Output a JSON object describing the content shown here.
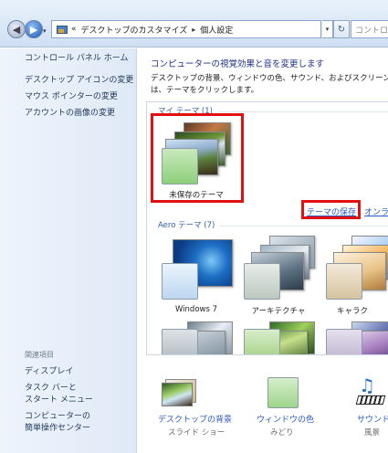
{
  "address_bar": {
    "breadcrumb_overflow": "«",
    "crumbs": [
      "デスクトップのカスタマイズ",
      "個人設定"
    ],
    "search_placeholder": "コントロー"
  },
  "sidebar": {
    "home": "コントロール パネル ホーム",
    "links": [
      "デスクトップ アイコンの変更",
      "マウス ポインターの変更",
      "アカウントの画像の変更"
    ],
    "related_heading": "関連項目",
    "related_links": [
      "ディスプレイ",
      "タスク バーと",
      "スタート メニュー",
      "コンピューターの",
      "簡単操作センター"
    ]
  },
  "main": {
    "title": "コンピューターの視覚効果と音を変更します",
    "desc_line1": "デスクトップの背景、ウィンドウの色、サウンド、およびスクリーン",
    "desc_line2": "は、テーマをクリックします。",
    "my_themes_label": "マイ テーマ (1)",
    "unsaved_theme": "未保存のテーマ",
    "save_theme_link": "テーマの保存",
    "online_link": "オンラ",
    "aero_label": "Aero テーマ (7)",
    "aero_themes": [
      "Windows 7",
      "アーキテクチャ",
      "キャラク"
    ]
  },
  "bottom_bar": {
    "items": [
      {
        "label": "デスクトップの背景",
        "sub": "スライド ショー"
      },
      {
        "label": "ウィンドウの色",
        "sub": "みどり"
      },
      {
        "label": "サウンド",
        "sub": "風景"
      }
    ]
  },
  "colors": {
    "highlight_red": "#e21010",
    "link_blue": "#2a58c4",
    "title_blue": "#1e3287"
  }
}
